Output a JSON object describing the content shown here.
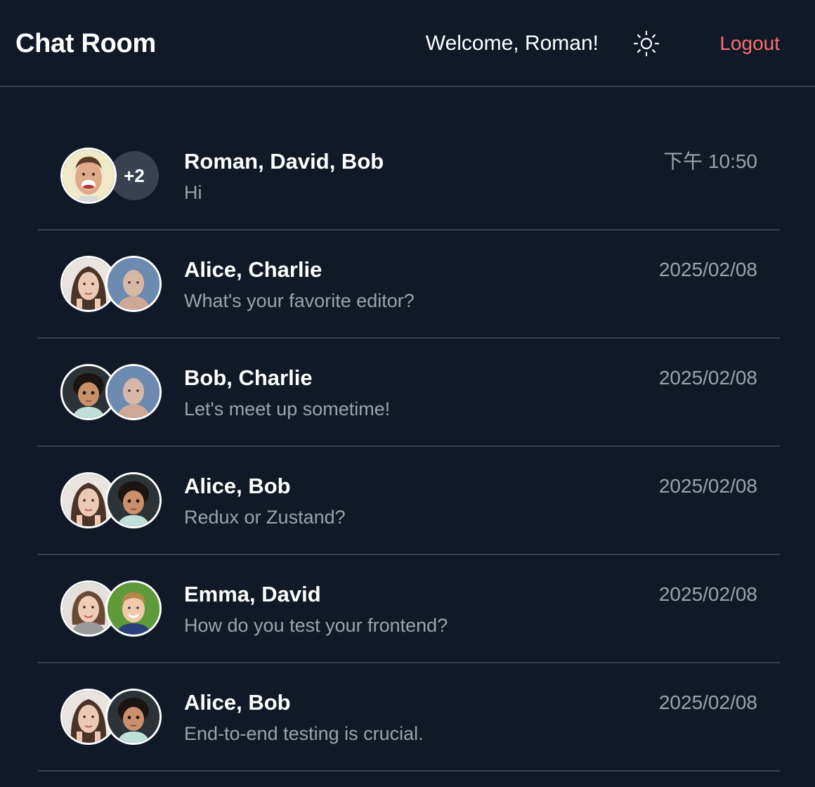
{
  "header": {
    "title": "Chat Room",
    "welcome": "Welcome, Roman!",
    "theme_icon": "sun-icon",
    "logout_label": "Logout"
  },
  "colors": {
    "background": "#111827",
    "divider": "#374151",
    "muted_text": "#9ca3af",
    "logout": "#f87171"
  },
  "chats": [
    {
      "names": "Roman, David, Bob",
      "preview": "Hi",
      "time": "下午 10:50",
      "avatars": [
        "roman"
      ],
      "extra_count": "+2"
    },
    {
      "names": "Alice, Charlie",
      "preview": "What's your favorite editor?",
      "time": "2025/02/08",
      "avatars": [
        "alice",
        "charlie"
      ]
    },
    {
      "names": "Bob, Charlie",
      "preview": "Let's meet up sometime!",
      "time": "2025/02/08",
      "avatars": [
        "bob",
        "charlie"
      ]
    },
    {
      "names": "Alice, Bob",
      "preview": "Redux or Zustand?",
      "time": "2025/02/08",
      "avatars": [
        "alice",
        "bob"
      ]
    },
    {
      "names": "Emma, David",
      "preview": "How do you test your frontend?",
      "time": "2025/02/08",
      "avatars": [
        "emma",
        "david"
      ]
    },
    {
      "names": "Alice, Bob",
      "preview": "End-to-end testing is crucial.",
      "time": "2025/02/08",
      "avatars": [
        "alice",
        "bob"
      ]
    }
  ]
}
